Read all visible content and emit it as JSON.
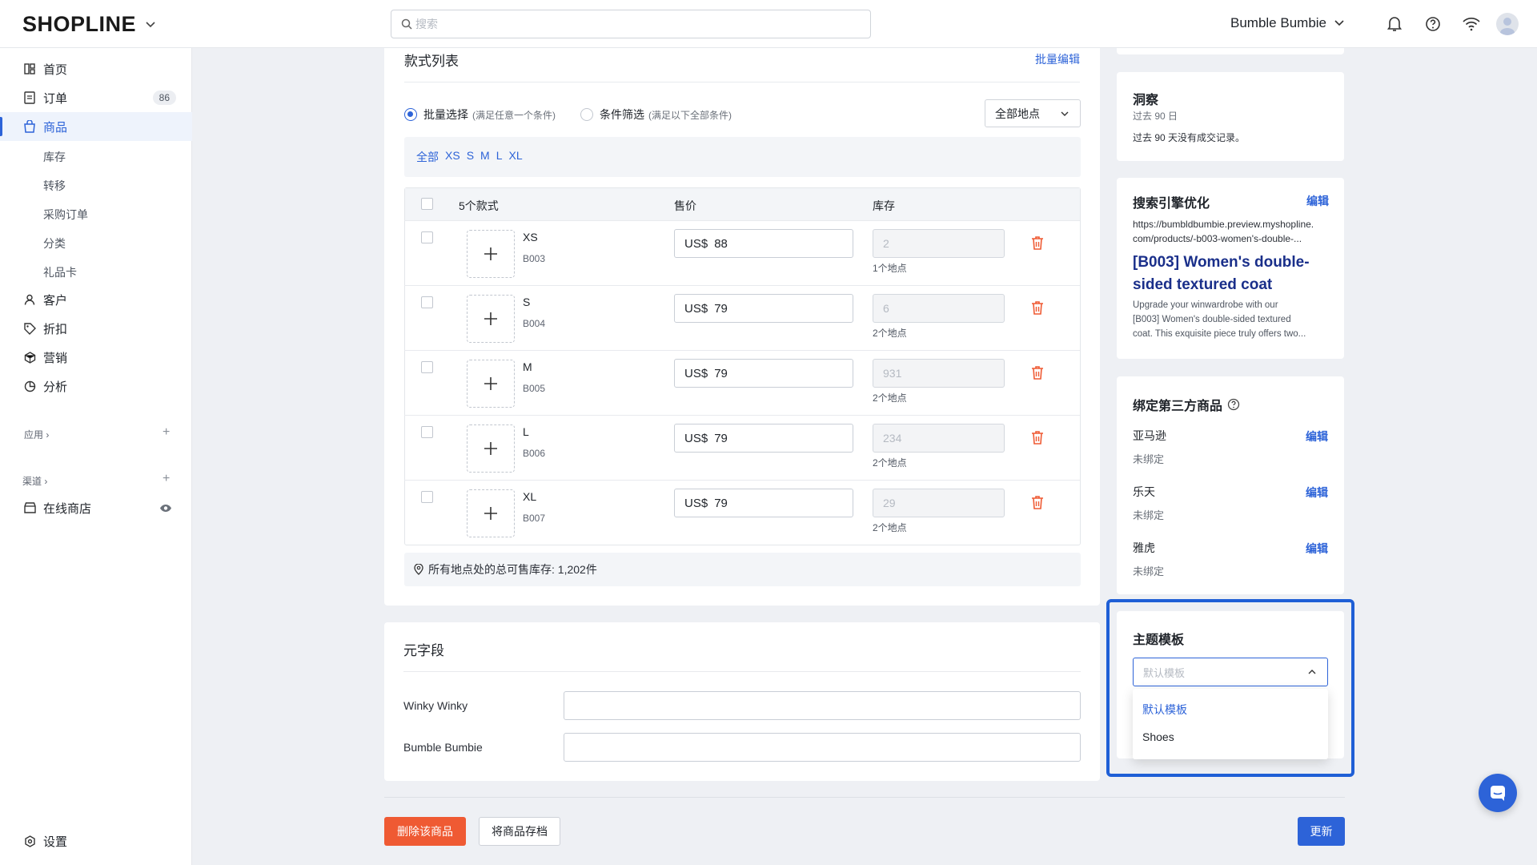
{
  "topbar": {
    "logo": "SHOPLINE",
    "search_placeholder": "搜索",
    "store_name": "Bumble Bumbie"
  },
  "sidebar": {
    "items": [
      {
        "label": "首页",
        "icon": "home-icon"
      },
      {
        "label": "订单",
        "icon": "orders-icon",
        "badge": "86"
      },
      {
        "label": "商品",
        "icon": "products-icon"
      },
      {
        "label": "客户",
        "icon": "customer-icon"
      },
      {
        "label": "折扣",
        "icon": "tag-icon"
      },
      {
        "label": "营销",
        "icon": "marketing-icon"
      },
      {
        "label": "分析",
        "icon": "analytics-icon"
      }
    ],
    "sub_items": [
      "库存",
      "转移",
      "采购订单",
      "分类",
      "礼品卡"
    ],
    "apps_label": "应用 ›",
    "channels_label": "渠道 ›",
    "online_store": "在线商店",
    "settings": "设置"
  },
  "variants": {
    "title": "款式列表",
    "bulk_edit": "批量编辑",
    "radio_bulk": "批量选择",
    "radio_bulk_hint": "(满足任意一个条件)",
    "radio_filter": "条件筛选",
    "radio_filter_hint": "(满足以下全部条件)",
    "location_select": "全部地点",
    "size_filters": [
      "全部",
      "XS",
      "S",
      "M",
      "L",
      "XL"
    ],
    "col_count": "5个款式",
    "col_price": "售价",
    "col_stock": "库存",
    "rows": [
      {
        "name": "XS",
        "sku": "B003",
        "currency": "US$",
        "price": "88",
        "stock": "2",
        "locations": "1个地点"
      },
      {
        "name": "S",
        "sku": "B004",
        "currency": "US$",
        "price": "79",
        "stock": "6",
        "locations": "2个地点"
      },
      {
        "name": "M",
        "sku": "B005",
        "currency": "US$",
        "price": "79",
        "stock": "931",
        "locations": "2个地点"
      },
      {
        "name": "L",
        "sku": "B006",
        "currency": "US$",
        "price": "79",
        "stock": "234",
        "locations": "2个地点"
      },
      {
        "name": "XL",
        "sku": "B007",
        "currency": "US$",
        "price": "79",
        "stock": "29",
        "locations": "2个地点"
      }
    ],
    "total_stock": "所有地点处的总可售库存: 1,202件"
  },
  "metafields": {
    "title": "元字段",
    "fields": [
      "Winky Winky",
      "Bumble Bumbie"
    ]
  },
  "insights": {
    "title": "洞察",
    "period": "过去 90 日",
    "note": "过去 90 天没有成交记录。"
  },
  "seo": {
    "title": "搜索引擎优化",
    "edit": "编辑",
    "url_line1": "https://bumbldbumbie.preview.myshopline.",
    "url_line2": "com/products/-b003-women's-double-...",
    "heading_line1": "[B003] Women's double-",
    "heading_line2": "sided textured coat",
    "desc_line1": "Upgrade your winwardrobe with our",
    "desc_line2": "[B003] Women's double-sided textured",
    "desc_line3": "coat. This exquisite piece truly offers two..."
  },
  "third_party": {
    "title": "绑定第三方商品",
    "items": [
      {
        "name": "亚马逊",
        "status": "未绑定",
        "edit": "编辑"
      },
      {
        "name": "乐天",
        "status": "未绑定",
        "edit": "编辑"
      },
      {
        "name": "雅虎",
        "status": "未绑定",
        "edit": "编辑"
      }
    ]
  },
  "theme": {
    "title": "主题模板",
    "placeholder": "默认模板",
    "options": [
      "默认模板",
      "Shoes"
    ]
  },
  "footer": {
    "delete": "删除该商品",
    "archive": "将商品存档",
    "update": "更新"
  },
  "colors": {
    "accent": "#2d63d8",
    "danger": "#ef5a33",
    "highlight": "#1f5fd6"
  }
}
